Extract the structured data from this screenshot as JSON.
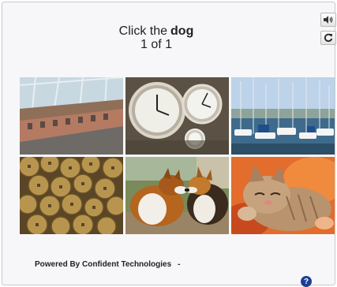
{
  "prompt": {
    "instruction": "Click the",
    "target": "dog",
    "progress": "1 of 1"
  },
  "controls": {
    "audio_icon": "speaker-icon",
    "refresh_icon": "refresh-icon"
  },
  "tiles": [
    {
      "subject": "train-under-glass-canopy"
    },
    {
      "subject": "pocket-watches"
    },
    {
      "subject": "harbor-sailboats"
    },
    {
      "subject": "coins"
    },
    {
      "subject": "two-collie-dogs"
    },
    {
      "subject": "sleeping-kitten"
    }
  ],
  "footer": {
    "powered_by": "Powered By Confident Technologies",
    "separator": "-"
  },
  "help": {
    "label": "?"
  },
  "colors": {
    "help_blue": "#1c3f93",
    "border": "#c9c9c9",
    "background": "#f7f7f9"
  }
}
